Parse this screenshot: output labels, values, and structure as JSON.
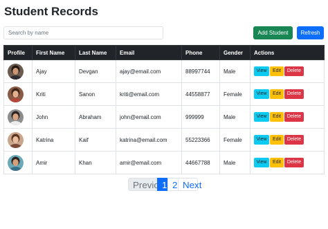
{
  "page": {
    "title": "Student Records"
  },
  "toolbar": {
    "search_placeholder": "Search by name",
    "search_value": "",
    "add_label": "Add Student",
    "refresh_label": "Refresh"
  },
  "colors": {
    "header_bg": "#212529",
    "add_button": "#198754",
    "refresh_button": "#0d6efd",
    "view_button": "#0dcaf0",
    "edit_button": "#ffc107",
    "delete_button": "#dc3545",
    "pager_active": "#0d6efd",
    "link": "#0d6efd"
  },
  "table": {
    "headers": [
      "Profile",
      "First Name",
      "Last Name",
      "Email",
      "Phone",
      "Gender",
      "Actions"
    ],
    "rows": [
      {
        "first": "Ajay",
        "last": "Devgan",
        "email": "ajay@email.com",
        "phone": "88997744",
        "gender": "Male",
        "avatar": "avatar-man-1"
      },
      {
        "first": "Kriti",
        "last": "Sanon",
        "email": "kriti@email.com",
        "phone": "44558877",
        "gender": "Female",
        "avatar": "avatar-woman-1"
      },
      {
        "first": "John",
        "last": "Abraham",
        "email": "john@email.com",
        "phone": "999999",
        "gender": "Male",
        "avatar": "avatar-man-2"
      },
      {
        "first": "Katrina",
        "last": "Kaif",
        "email": "katrina@email.com",
        "phone": "55223366",
        "gender": "Female",
        "avatar": "avatar-woman-2"
      },
      {
        "first": "Amir",
        "last": "Khan",
        "email": "amir@email.com",
        "phone": "44667788",
        "gender": "Male",
        "avatar": "avatar-man-3"
      }
    ],
    "actions": {
      "view": "View",
      "edit": "Edit",
      "delete": "Delete"
    }
  },
  "pagination": {
    "previous": "Previous",
    "pages": [
      "1",
      "2"
    ],
    "current": "1",
    "next": "Next"
  }
}
